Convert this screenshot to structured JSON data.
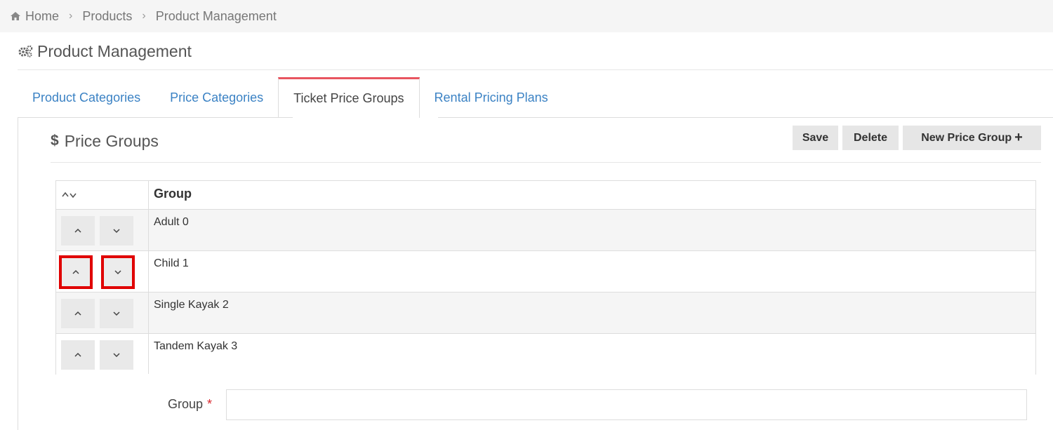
{
  "breadcrumb": {
    "home": "Home",
    "products": "Products",
    "current": "Product Management",
    "separator": "›"
  },
  "page": {
    "title": "Product Management"
  },
  "tabs": [
    {
      "label": "Product Categories",
      "active": false
    },
    {
      "label": "Price Categories",
      "active": false
    },
    {
      "label": "Ticket Price Groups",
      "active": true
    },
    {
      "label": "Rental Pricing Plans",
      "active": false
    }
  ],
  "section": {
    "icon_symbol": "$",
    "title": "Price Groups"
  },
  "toolbar": {
    "save_label": "Save",
    "delete_label": "Delete",
    "new_label": "New Price Group",
    "new_icon": "+"
  },
  "grid": {
    "sort_icon": "up-down-chevrons",
    "column_group": "Group",
    "rows": [
      {
        "label": "Adult 0",
        "highlighted": false
      },
      {
        "label": "Child 1",
        "highlighted": true
      },
      {
        "label": "Single Kayak 2",
        "highlighted": false
      },
      {
        "label": "Tandem Kayak 3",
        "highlighted": false
      }
    ]
  },
  "form": {
    "group_label": "Group",
    "required_marker": "*",
    "group_value": ""
  },
  "colors": {
    "tab_link": "#3b82c4",
    "active_tab_accent": "#e8555f",
    "highlight": "#e00000",
    "required": "#d9262c"
  }
}
